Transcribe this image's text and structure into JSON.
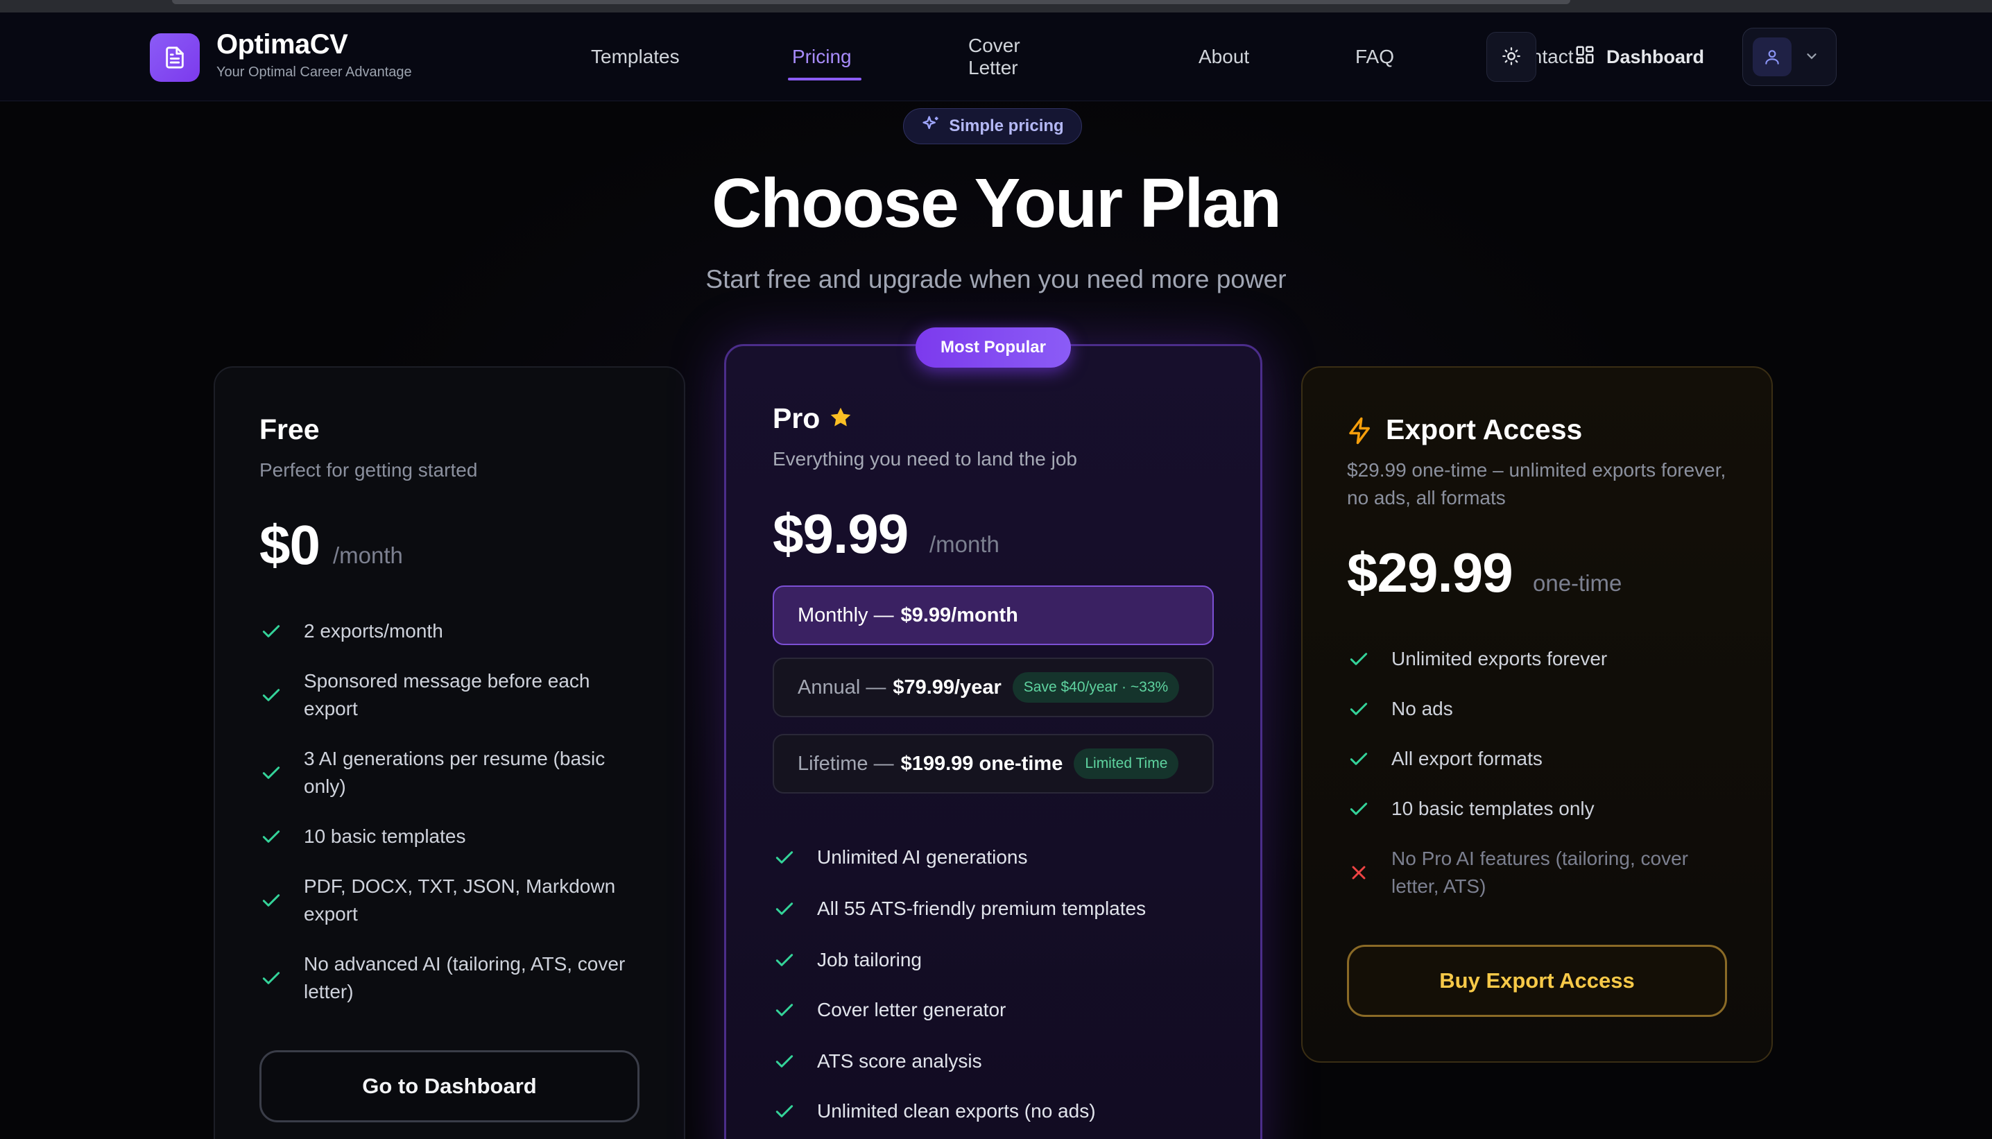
{
  "brand": {
    "name": "OptimaCV",
    "tagline": "Your Optimal Career Advantage"
  },
  "nav": {
    "items": [
      {
        "label": "Templates"
      },
      {
        "label": "Pricing"
      },
      {
        "label": "Cover Letter"
      },
      {
        "label": "About"
      },
      {
        "label": "FAQ"
      },
      {
        "label": "Contact"
      }
    ],
    "active": "Pricing",
    "dashboard_label": "Dashboard"
  },
  "hero": {
    "badge": "Simple pricing",
    "title": "Choose Your Plan",
    "subtitle": "Start free and upgrade when you need more power"
  },
  "plans": {
    "free": {
      "name": "Free",
      "description": "Perfect for getting started",
      "price": "$0",
      "period": "/month",
      "features": [
        {
          "text": "2 exports/month",
          "included": true
        },
        {
          "text": "Sponsored message before each export",
          "included": true
        },
        {
          "text": "3 AI generations per resume (basic only)",
          "included": true
        },
        {
          "text": "10 basic templates",
          "included": true
        },
        {
          "text": "PDF, DOCX, TXT, JSON, Markdown export",
          "included": true
        },
        {
          "text": "No advanced AI (tailoring, ATS, cover letter)",
          "included": true
        }
      ],
      "cta": "Go to Dashboard"
    },
    "pro": {
      "badge": "Most Popular",
      "name": "Pro",
      "description": "Everything you need to land the job",
      "price": "$9.99",
      "period": "/month",
      "options": [
        {
          "prefix": "Monthly — ",
          "price": "$9.99/month",
          "tag": "",
          "selected": true
        },
        {
          "prefix": "Annual — ",
          "price": "$79.99/year",
          "tag": "Save $40/year · ~33%",
          "selected": false
        },
        {
          "prefix": "Lifetime — ",
          "price": "$199.99 one-time",
          "tag": "Limited Time",
          "selected": false
        }
      ],
      "features": [
        {
          "text": "Unlimited AI generations",
          "included": true
        },
        {
          "text": "All 55 ATS-friendly premium templates",
          "included": true
        },
        {
          "text": "Job tailoring",
          "included": true
        },
        {
          "text": "Cover letter generator",
          "included": true
        },
        {
          "text": "ATS score analysis",
          "included": true
        },
        {
          "text": "Unlimited clean exports (no ads)",
          "included": true
        }
      ]
    },
    "export": {
      "name": "Export Access",
      "description": "$29.99 one-time – unlimited exports forever, no ads, all formats",
      "price": "$29.99",
      "period": "one-time",
      "features": [
        {
          "text": "Unlimited exports forever",
          "included": true
        },
        {
          "text": "No ads",
          "included": true
        },
        {
          "text": "All export formats",
          "included": true
        },
        {
          "text": "10 basic templates only",
          "included": true
        },
        {
          "text": "No Pro AI features (tailoring, cover letter, ATS)",
          "included": false
        }
      ],
      "cta": "Buy Export Access"
    }
  },
  "colors": {
    "accent": "#8b5cf6",
    "check": "#34d399",
    "cross": "#ef4444",
    "gold": "#f7c948",
    "star": "#fbbf24"
  },
  "icons": {
    "logo": "document-icon",
    "badge": "sparkles-icon",
    "theme": "sun-icon",
    "dashboard": "grid-icon",
    "user": "user-icon",
    "dropdown": "chevron-down-icon",
    "pro": "star-icon",
    "export": "lightning-icon",
    "included": "check-icon",
    "excluded": "x-icon"
  }
}
